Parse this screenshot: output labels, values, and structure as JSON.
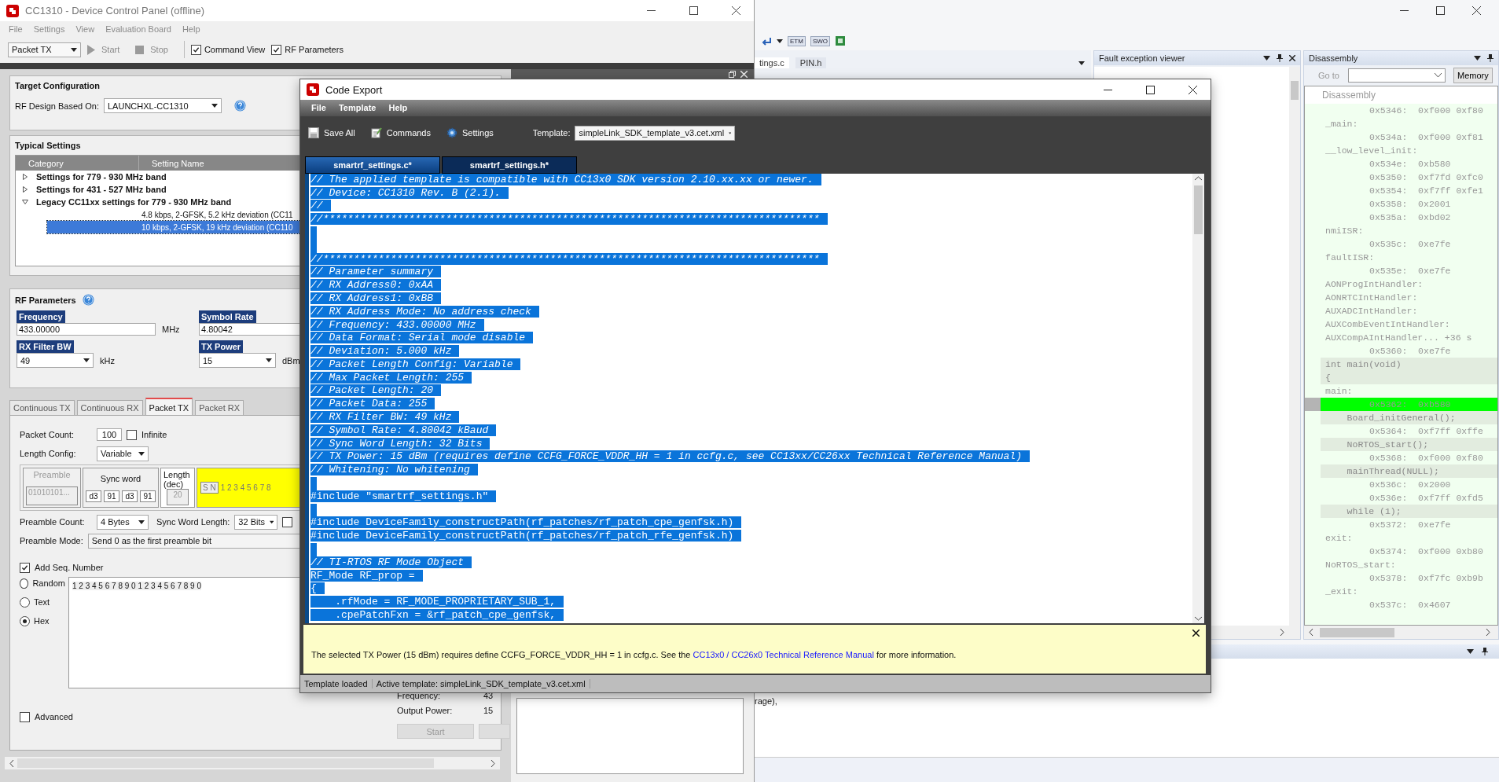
{
  "device_window": {
    "title": "CC1310 - Device Control Panel (offline)",
    "menu": [
      "File",
      "Settings",
      "View",
      "Evaluation Board",
      "Help"
    ],
    "toolbar": {
      "mode": "Packet TX",
      "start": "Start",
      "stop": "Stop",
      "toggles": [
        {
          "label": "Command View",
          "checked": true
        },
        {
          "label": "RF Parameters",
          "checked": true
        }
      ]
    },
    "target_configuration": {
      "title": "Target Configuration",
      "label": "RF Design Based On:",
      "value": "LAUNCHXL-CC1310"
    },
    "typical_settings": {
      "title": "Typical Settings",
      "columns": [
        "Category",
        "Setting Name"
      ],
      "tree": [
        {
          "label": "Settings for 779 - 930 MHz band",
          "expanded": false,
          "selected": false
        },
        {
          "label": "Settings for 431 - 527 MHz band",
          "expanded": false,
          "selected": false
        },
        {
          "label": "Legacy CC11xx settings for 779 - 930 MHz band",
          "expanded": true,
          "selected": false,
          "children": [
            {
              "label": "4.8 kbps, 2-GFSK, 5.2 kHz deviation (CC11",
              "selected": false
            },
            {
              "label": "10 kbps, 2-GFSK, 19 kHz deviation (CC110",
              "selected": true
            }
          ]
        }
      ]
    },
    "rf_parameters": {
      "title": "RF Parameters",
      "fields": [
        {
          "label": "Frequency",
          "kind": "input",
          "value": "433.00000",
          "unit": "MHz"
        },
        {
          "label": "Symbol Rate",
          "kind": "input",
          "value": "4.80042"
        },
        {
          "label": "RX Filter BW",
          "kind": "select",
          "value": "49",
          "unit": "kHz"
        },
        {
          "label": "TX Power",
          "kind": "select",
          "value": "15",
          "unit": "dBm"
        }
      ]
    },
    "tabs": [
      {
        "label": "Continuous TX",
        "selected": false
      },
      {
        "label": "Continuous RX",
        "selected": false
      },
      {
        "label": "Packet TX",
        "selected": true
      },
      {
        "label": "Packet RX",
        "selected": false
      }
    ],
    "packet_tx": {
      "packet_count": {
        "label": "Packet Count:",
        "value": "100"
      },
      "infinite": {
        "label": "Infinite",
        "checked": false
      },
      "length_config": {
        "label": "Length Config:",
        "value": "Variable"
      },
      "structure": {
        "preamble": {
          "label": "Preamble",
          "value": "01010101...",
          "disabled": true
        },
        "sync_word": {
          "label": "Sync word",
          "bytes": [
            "d3",
            "91",
            "d3",
            "91"
          ]
        },
        "length": {
          "label": "Length (dec)",
          "value": "20",
          "disabled": true
        },
        "seq": "S N",
        "data": "1 2 3 4 5 6 7 8"
      },
      "preamble_count": {
        "label": "Preamble Count:",
        "value": "4 Bytes"
      },
      "sync_word_length": {
        "label": "Sync Word Length:",
        "value": "32 Bits",
        "checked": false
      },
      "preamble_mode": {
        "label": "Preamble Mode:",
        "value": "Send 0 as the first preamble bit"
      },
      "add_seq": {
        "label": "Add Seq. Number",
        "checked": true
      },
      "payload_modes": [
        {
          "label": "Random",
          "selected": false
        },
        {
          "label": "Text",
          "selected": false
        },
        {
          "label": "Hex",
          "selected": true
        }
      ],
      "payload": "1 2 3 4 5 6 7 8 9 0 1 2 3 4 5 6 7 8 9 0",
      "advanced": {
        "label": "Advanced",
        "checked": false
      },
      "summary": [
        {
          "label": "Frequency:",
          "value": "43"
        },
        {
          "label": "Output Power:",
          "value": "15"
        }
      ],
      "start_button": "Start"
    }
  },
  "code_export": {
    "title": "Code Export",
    "menu": [
      "File",
      "Template",
      "Help"
    ],
    "toolbar": [
      {
        "label": "Save All",
        "kind": "save"
      },
      {
        "label": "Commands",
        "kind": "commands"
      },
      {
        "label": "Settings",
        "kind": "settings"
      }
    ],
    "template_label": "Template:",
    "template": "simpleLink_SDK_template_v3.cet.xml",
    "tabs": [
      {
        "label": "smartrf_settings.c*",
        "selected": true
      },
      {
        "label": "smartrf_settings.h*",
        "selected": false
      }
    ],
    "code": {
      "selected": true,
      "lines": [
        {
          "kind": "comment",
          "text": "// The applied template is compatible with CC13x0 SDK version 2.10.xx.xx or newer."
        },
        {
          "kind": "comment",
          "text": "// Device: CC1310 Rev. B (2.1)."
        },
        {
          "kind": "comment",
          "text": "//"
        },
        {
          "kind": "comment",
          "text": "//*********************************************************************************"
        },
        {
          "kind": "blank"
        },
        {
          "kind": "blank"
        },
        {
          "kind": "comment",
          "text": "//*********************************************************************************"
        },
        {
          "kind": "comment",
          "text": "// Parameter summary"
        },
        {
          "kind": "comment",
          "text": "// RX Address0: 0xAA"
        },
        {
          "kind": "comment",
          "text": "// RX Address1: 0xBB"
        },
        {
          "kind": "comment",
          "text": "// RX Address Mode: No address check"
        },
        {
          "kind": "comment",
          "text": "// Frequency: 433.00000 MHz"
        },
        {
          "kind": "comment",
          "text": "// Data Format: Serial mode disable"
        },
        {
          "kind": "comment",
          "text": "// Deviation: 5.000 kHz"
        },
        {
          "kind": "comment",
          "text": "// Packet Length Config: Variable"
        },
        {
          "kind": "comment",
          "text": "// Max Packet Length: 255"
        },
        {
          "kind": "comment",
          "text": "// Packet Length: 20"
        },
        {
          "kind": "comment",
          "text": "// Packet Data: 255"
        },
        {
          "kind": "comment",
          "text": "// RX Filter BW: 49 kHz"
        },
        {
          "kind": "comment",
          "text": "// Symbol Rate: 4.80042 kBaud"
        },
        {
          "kind": "comment",
          "text": "// Sync Word Length: 32 Bits"
        },
        {
          "kind": "comment",
          "text": "// TX Power: 15 dBm (requires define CCFG_FORCE_VDDR_HH = 1 in ccfg.c, see CC13xx/CC26xx Technical Reference Manual)"
        },
        {
          "kind": "comment",
          "text": "// Whitening: No whitening"
        },
        {
          "kind": "blank"
        },
        {
          "kind": "code",
          "text": "#include \"smartrf_settings.h\""
        },
        {
          "kind": "blank"
        },
        {
          "kind": "code",
          "text": "#include DeviceFamily_constructPath(rf_patches/rf_patch_cpe_genfsk.h)"
        },
        {
          "kind": "code",
          "text": "#include DeviceFamily_constructPath(rf_patches/rf_patch_rfe_genfsk.h)"
        },
        {
          "kind": "blank"
        },
        {
          "kind": "comment",
          "text": "// TI-RTOS RF Mode Object"
        },
        {
          "kind": "code",
          "text": "RF_Mode RF_prop ="
        },
        {
          "kind": "code",
          "text": "{"
        },
        {
          "kind": "code",
          "text": "    .rfMode = RF_MODE_PROPRIETARY_SUB_1,"
        },
        {
          "kind": "code",
          "text": "    .cpePatchFxn = &rf_patch_cpe_genfsk,"
        }
      ]
    },
    "info": {
      "before": "The selected TX Power (15 dBm) requires define CCFG_FORCE_VDDR_HH = 1 in ccfg.c. See the ",
      "link": "CC13x0 / CC26x0 Technical Reference Manual",
      "after": " for more information."
    },
    "status": [
      "Template loaded",
      "Active template: simpleLink_SDK_template_v3.cet.xml"
    ]
  },
  "ide": {
    "toolbar_labels": [
      "ETM",
      "SWO"
    ],
    "editor_tabs": [
      {
        "label": "tings.c",
        "selected": true
      },
      {
        "label": "PIN.h",
        "selected": false
      }
    ],
    "fault_viewer": {
      "title": "Fault exception viewer"
    },
    "disassembly": {
      "title": "Disassembly",
      "goto_label": "Go to",
      "memory_button": "Memory",
      "list_header": "Disassembly",
      "lines": [
        {
          "kind": "address",
          "text": "0x5346:  0xf000 0xf80"
        },
        {
          "kind": "label",
          "text": "_main:"
        },
        {
          "kind": "address",
          "text": "0x534a:  0xf000 0xf81"
        },
        {
          "kind": "label",
          "text": "__low_level_init:"
        },
        {
          "kind": "address",
          "text": "0x534e:  0xb580"
        },
        {
          "kind": "address",
          "text": "0x5350:  0xf7fd 0xfc0"
        },
        {
          "kind": "address",
          "text": "0x5354:  0xf7ff 0xfe1"
        },
        {
          "kind": "address",
          "text": "0x5358:  0x2001"
        },
        {
          "kind": "address",
          "text": "0x535a:  0xbd02"
        },
        {
          "kind": "label",
          "text": "nmiISR:"
        },
        {
          "kind": "address",
          "text": "0x535c:  0xe7fe"
        },
        {
          "kind": "label",
          "text": "faultISR:"
        },
        {
          "kind": "address",
          "text": "0x535e:  0xe7fe"
        },
        {
          "kind": "label",
          "text": "AONProgIntHandler:"
        },
        {
          "kind": "label",
          "text": "AONRTCIntHandler:"
        },
        {
          "kind": "label",
          "text": "AUXADCIntHandler:"
        },
        {
          "kind": "label",
          "text": "AUXCombEventIntHandler:"
        },
        {
          "kind": "label",
          "text": "AUXCompAIntHandler... +36 s"
        },
        {
          "kind": "address",
          "text": "0x5360:  0xe7fe"
        },
        {
          "kind": "source",
          "text": "int main(void)"
        },
        {
          "kind": "source",
          "text": "{"
        },
        {
          "kind": "label",
          "text": "main:"
        },
        {
          "kind": "current",
          "text": "0x5362:  0xb580"
        },
        {
          "kind": "source",
          "text": "    Board_initGeneral();"
        },
        {
          "kind": "address",
          "text": "0x5364:  0xf7ff 0xffe"
        },
        {
          "kind": "source",
          "text": "    NoRTOS_start();"
        },
        {
          "kind": "address",
          "text": "0x5368:  0xf000 0xf80"
        },
        {
          "kind": "source",
          "text": "    mainThread(NULL);"
        },
        {
          "kind": "address",
          "text": "0x536c:  0x2000"
        },
        {
          "kind": "address",
          "text": "0x536e:  0xf7ff 0xfd5"
        },
        {
          "kind": "source",
          "text": "    while (1);"
        },
        {
          "kind": "address",
          "text": "0x5372:  0xe7fe"
        },
        {
          "kind": "label",
          "text": "exit:"
        },
        {
          "kind": "address",
          "text": "0x5374:  0xf000 0xb80"
        },
        {
          "kind": "label",
          "text": "NoRTOS_start:"
        },
        {
          "kind": "address",
          "text": "0x5378:  0xf7fc 0xb9b"
        },
        {
          "kind": "label",
          "text": "_exit:"
        },
        {
          "kind": "address",
          "text": "0x537c:  0x4607"
        }
      ]
    },
    "output_text": "rage),"
  }
}
